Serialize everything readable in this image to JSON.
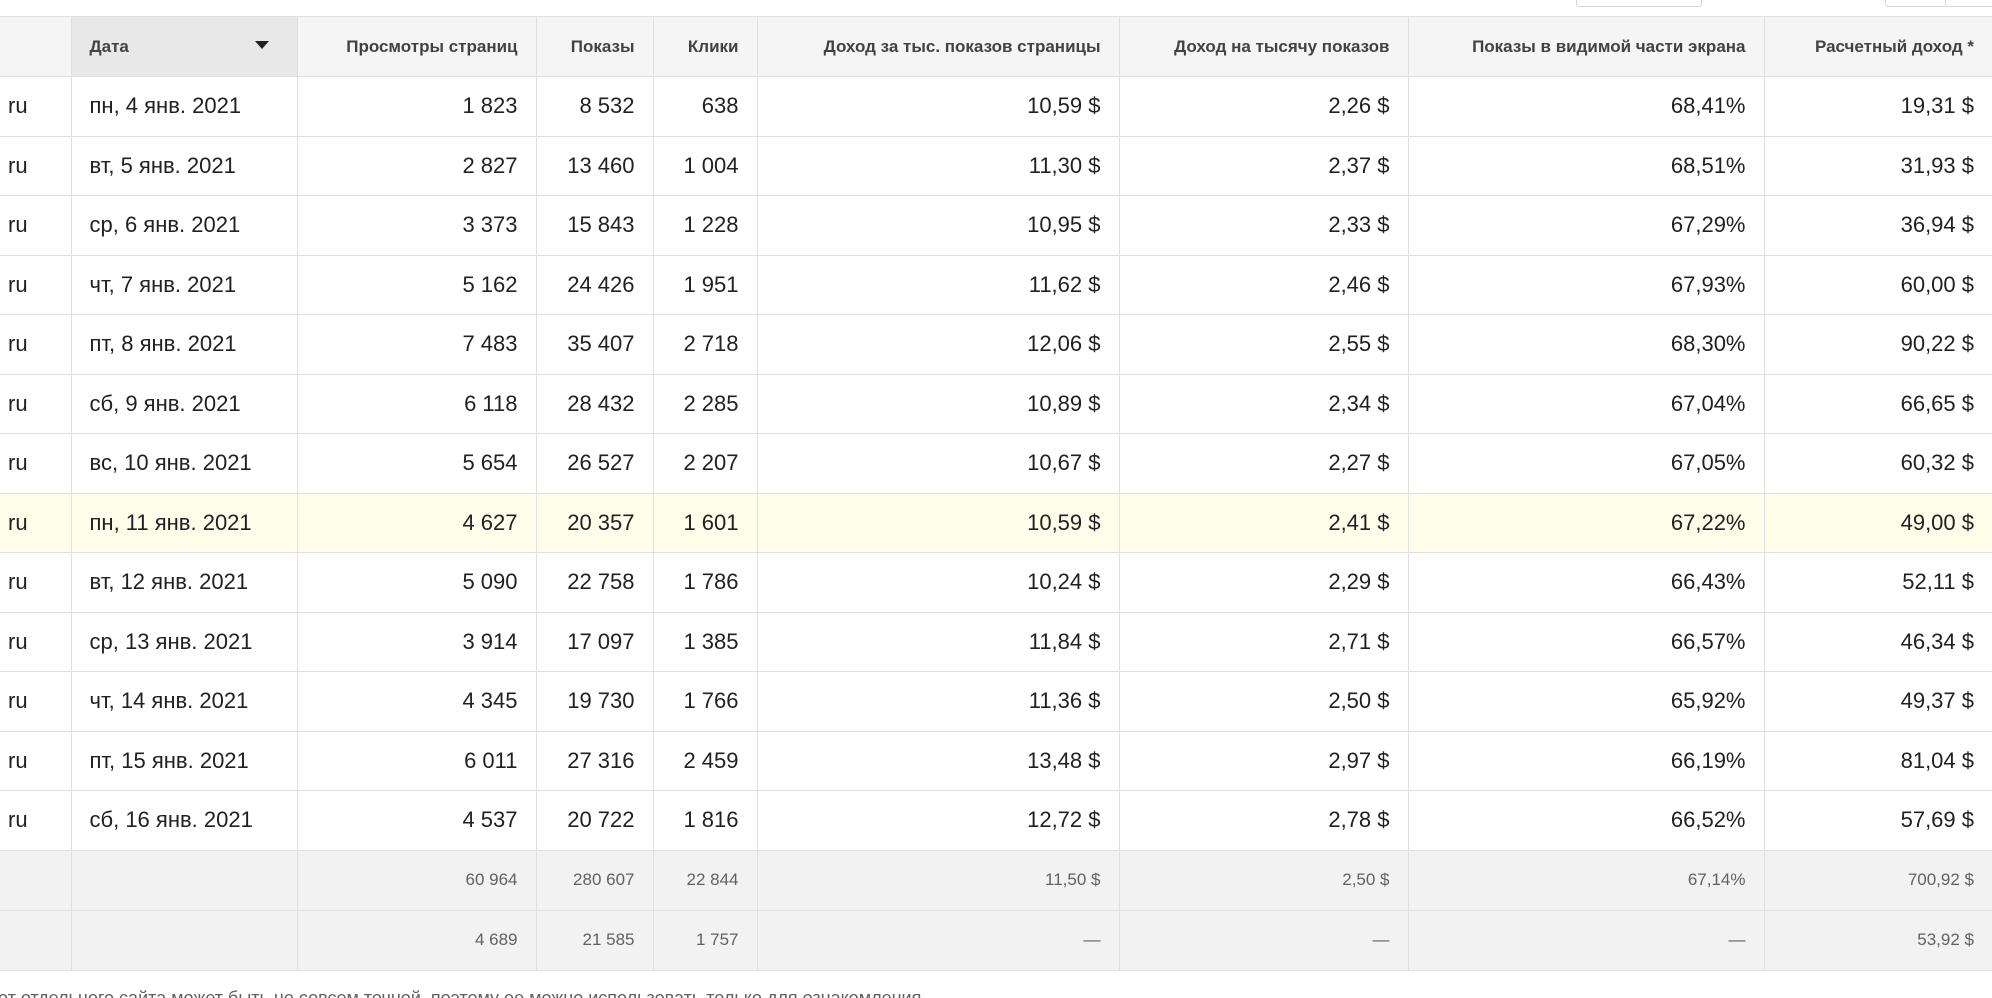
{
  "columns": {
    "site": "",
    "date": "Дата",
    "page_views": "Просмотры страниц",
    "impressions": "Показы",
    "clicks": "Клики",
    "page_rpm": "Доход за тыс. показов страницы",
    "impression_rpm": "Доход на тысячу показов",
    "active_view": "Показы в видимой части экрана",
    "revenue": "Расчетный доход *"
  },
  "rows": [
    {
      "site": "ru",
      "date": "пн, 4 янв. 2021",
      "page_views": "1 823",
      "impressions": "8 532",
      "clicks": "638",
      "page_rpm": "10,59 $",
      "impression_rpm": "2,26 $",
      "active_view": "68,41%",
      "revenue": "19,31 $"
    },
    {
      "site": "ru",
      "date": "вт, 5 янв. 2021",
      "page_views": "2 827",
      "impressions": "13 460",
      "clicks": "1 004",
      "page_rpm": "11,30 $",
      "impression_rpm": "2,37 $",
      "active_view": "68,51%",
      "revenue": "31,93 $"
    },
    {
      "site": "ru",
      "date": "ср, 6 янв. 2021",
      "page_views": "3 373",
      "impressions": "15 843",
      "clicks": "1 228",
      "page_rpm": "10,95 $",
      "impression_rpm": "2,33 $",
      "active_view": "67,29%",
      "revenue": "36,94 $"
    },
    {
      "site": "ru",
      "date": "чт, 7 янв. 2021",
      "page_views": "5 162",
      "impressions": "24 426",
      "clicks": "1 951",
      "page_rpm": "11,62 $",
      "impression_rpm": "2,46 $",
      "active_view": "67,93%",
      "revenue": "60,00 $"
    },
    {
      "site": "ru",
      "date": "пт, 8 янв. 2021",
      "page_views": "7 483",
      "impressions": "35 407",
      "clicks": "2 718",
      "page_rpm": "12,06 $",
      "impression_rpm": "2,55 $",
      "active_view": "68,30%",
      "revenue": "90,22 $"
    },
    {
      "site": "ru",
      "date": "сб, 9 янв. 2021",
      "page_views": "6 118",
      "impressions": "28 432",
      "clicks": "2 285",
      "page_rpm": "10,89 $",
      "impression_rpm": "2,34 $",
      "active_view": "67,04%",
      "revenue": "66,65 $"
    },
    {
      "site": "ru",
      "date": "вс, 10 янв. 2021",
      "page_views": "5 654",
      "impressions": "26 527",
      "clicks": "2 207",
      "page_rpm": "10,67 $",
      "impression_rpm": "2,27 $",
      "active_view": "67,05%",
      "revenue": "60,32 $"
    },
    {
      "site": "ru",
      "date": "пн, 11 янв. 2021",
      "page_views": "4 627",
      "impressions": "20 357",
      "clicks": "1 601",
      "page_rpm": "10,59 $",
      "impression_rpm": "2,41 $",
      "active_view": "67,22%",
      "revenue": "49,00 $",
      "highlight": true
    },
    {
      "site": "ru",
      "date": "вт, 12 янв. 2021",
      "page_views": "5 090",
      "impressions": "22 758",
      "clicks": "1 786",
      "page_rpm": "10,24 $",
      "impression_rpm": "2,29 $",
      "active_view": "66,43%",
      "revenue": "52,11 $"
    },
    {
      "site": "ru",
      "date": "ср, 13 янв. 2021",
      "page_views": "3 914",
      "impressions": "17 097",
      "clicks": "1 385",
      "page_rpm": "11,84 $",
      "impression_rpm": "2,71 $",
      "active_view": "66,57%",
      "revenue": "46,34 $"
    },
    {
      "site": "ru",
      "date": "чт, 14 янв. 2021",
      "page_views": "4 345",
      "impressions": "19 730",
      "clicks": "1 766",
      "page_rpm": "11,36 $",
      "impression_rpm": "2,50 $",
      "active_view": "65,92%",
      "revenue": "49,37 $"
    },
    {
      "site": "ru",
      "date": "пт, 15 янв. 2021",
      "page_views": "6 011",
      "impressions": "27 316",
      "clicks": "2 459",
      "page_rpm": "13,48 $",
      "impression_rpm": "2,97 $",
      "active_view": "66,19%",
      "revenue": "81,04 $"
    },
    {
      "site": "ru",
      "date": "сб, 16 янв. 2021",
      "page_views": "4 537",
      "impressions": "20 722",
      "clicks": "1 816",
      "page_rpm": "12,72 $",
      "impression_rpm": "2,78 $",
      "active_view": "66,52%",
      "revenue": "57,69 $"
    }
  ],
  "totals": {
    "page_views": "60 964",
    "impressions": "280 607",
    "clicks": "22 844",
    "page_rpm": "11,50 $",
    "impression_rpm": "2,50 $",
    "active_view": "67,14%",
    "revenue": "700,92 $"
  },
  "averages": {
    "page_views": "4 689",
    "impressions": "21 585",
    "clicks": "1 757",
    "page_rpm": "—",
    "impression_rpm": "—",
    "active_view": "—",
    "revenue": "53,92 $"
  },
  "footnote": "от отдельного сайта может быть не совсем точной, поэтому ее можно использовать только для ознакомления.",
  "colors": {
    "header_bg": "#f5f5f5",
    "sorted_header_bg": "#e8e8e8",
    "highlight_row": "#fdfde9",
    "footer_bg": "#f2f2f2",
    "grid": "#e0e0e0"
  }
}
